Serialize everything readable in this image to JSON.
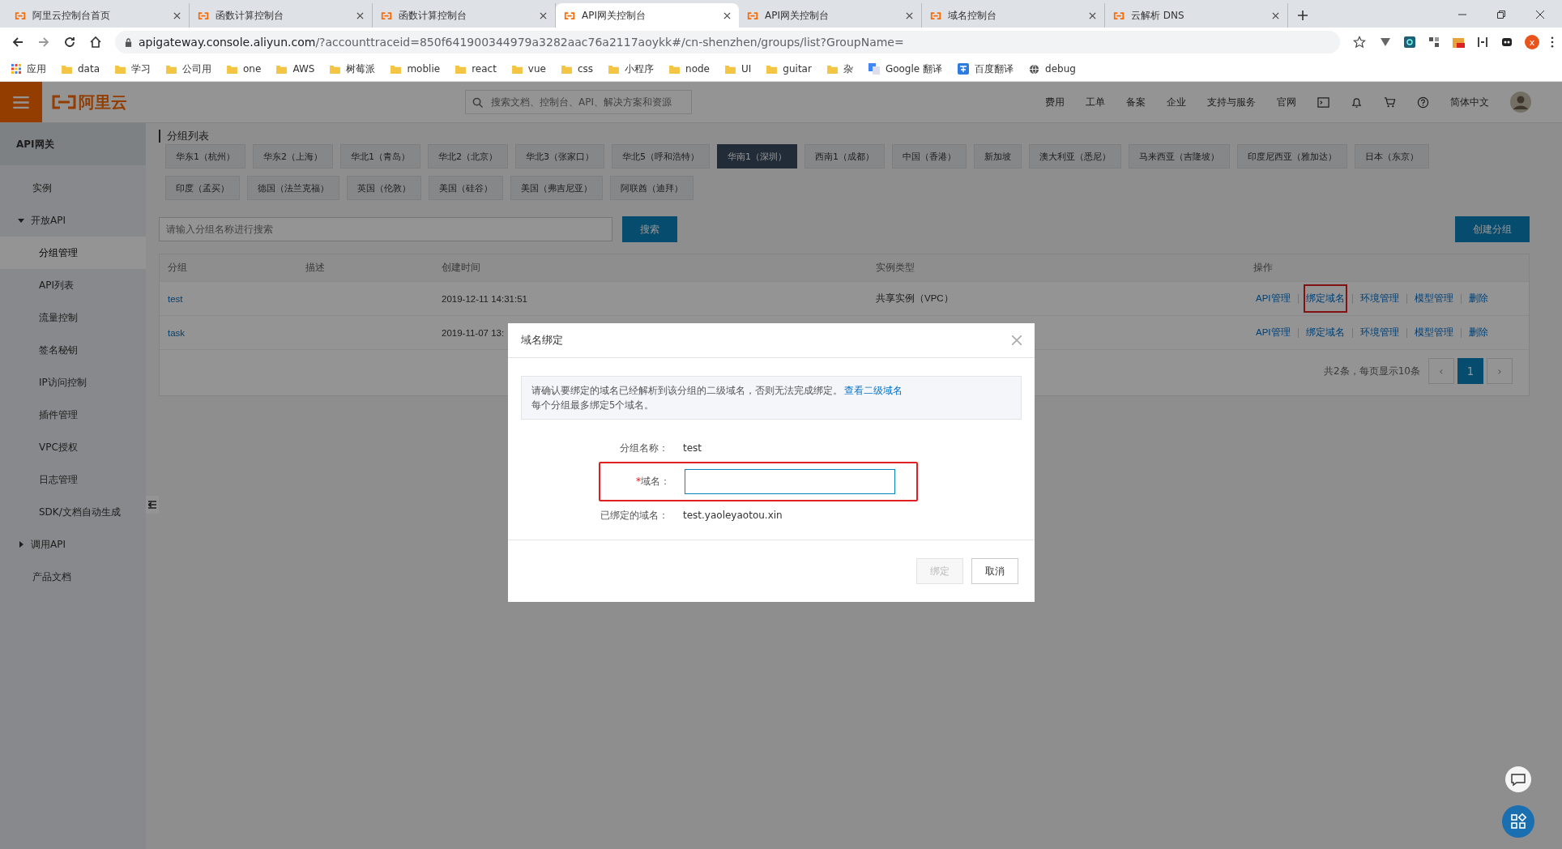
{
  "browser": {
    "tabs": [
      {
        "title": "阿里云控制台首页",
        "selected": false
      },
      {
        "title": "函数计算控制台",
        "selected": false
      },
      {
        "title": "函数计算控制台",
        "selected": false
      },
      {
        "title": "API网关控制台",
        "selected": true
      },
      {
        "title": "API网关控制台",
        "selected": false
      },
      {
        "title": "域名控制台",
        "selected": false
      },
      {
        "title": "云解析 DNS",
        "selected": false
      }
    ],
    "url_host": "apigateway.console.aliyun.com",
    "url_rest": "/?accounttraceid=850f641900344979a3282aac76a2117aoykk#/cn-shenzhen/groups/list?GroupName=",
    "profile_letter": "x",
    "bookmarks": [
      {
        "label": "应用",
        "kind": "apps"
      },
      {
        "label": "data",
        "kind": "folder"
      },
      {
        "label": "学习",
        "kind": "folder"
      },
      {
        "label": "公司用",
        "kind": "folder"
      },
      {
        "label": "one",
        "kind": "folder"
      },
      {
        "label": "AWS",
        "kind": "folder"
      },
      {
        "label": "树莓派",
        "kind": "folder"
      },
      {
        "label": "moblie",
        "kind": "folder"
      },
      {
        "label": "react",
        "kind": "folder"
      },
      {
        "label": "vue",
        "kind": "folder"
      },
      {
        "label": "css",
        "kind": "folder"
      },
      {
        "label": "小程序",
        "kind": "folder"
      },
      {
        "label": "node",
        "kind": "folder"
      },
      {
        "label": "UI",
        "kind": "folder"
      },
      {
        "label": "guitar",
        "kind": "folder"
      },
      {
        "label": "杂",
        "kind": "folder"
      },
      {
        "label": "Google 翻译",
        "kind": "translate"
      },
      {
        "label": "百度翻译",
        "kind": "baidu"
      },
      {
        "label": "debug",
        "kind": "link"
      }
    ]
  },
  "header": {
    "logo": "阿里云",
    "search_placeholder": "搜索文档、控制台、API、解决方案和资源",
    "nav": [
      "费用",
      "工单",
      "备案",
      "企业",
      "支持与服务",
      "官网"
    ],
    "language": "简体中文"
  },
  "sidebar": {
    "title": "API网关",
    "items": [
      {
        "label": "实例",
        "selected": false
      },
      {
        "label": "开放API",
        "expanded": true,
        "selected": false,
        "children": [
          {
            "label": "分组管理",
            "selected": true
          },
          {
            "label": "API列表",
            "selected": false
          },
          {
            "label": "流量控制",
            "selected": false
          },
          {
            "label": "签名秘钥",
            "selected": false
          },
          {
            "label": "IP访问控制",
            "selected": false
          },
          {
            "label": "插件管理",
            "selected": false
          },
          {
            "label": "VPC授权",
            "selected": false
          },
          {
            "label": "日志管理",
            "selected": false
          },
          {
            "label": "SDK/文档自动生成",
            "selected": false
          }
        ]
      },
      {
        "label": "调用API",
        "expanded": false,
        "selected": false
      },
      {
        "label": "产品文档",
        "selected": false
      }
    ]
  },
  "page": {
    "title": "分组列表",
    "regions": [
      {
        "label": "华东1（杭州）",
        "selected": false
      },
      {
        "label": "华东2（上海）",
        "selected": false
      },
      {
        "label": "华北1（青岛）",
        "selected": false
      },
      {
        "label": "华北2（北京）",
        "selected": false
      },
      {
        "label": "华北3（张家口）",
        "selected": false
      },
      {
        "label": "华北5（呼和浩特）",
        "selected": false
      },
      {
        "label": "华南1（深圳）",
        "selected": true
      },
      {
        "label": "西南1（成都）",
        "selected": false
      },
      {
        "label": "中国（香港）",
        "selected": false
      },
      {
        "label": "新加坡",
        "selected": false
      },
      {
        "label": "澳大利亚（悉尼）",
        "selected": false
      },
      {
        "label": "马来西亚（吉隆坡）",
        "selected": false
      },
      {
        "label": "印度尼西亚（雅加达）",
        "selected": false
      },
      {
        "label": "日本（东京）",
        "selected": false
      },
      {
        "label": "印度（孟买）",
        "selected": false
      },
      {
        "label": "德国（法兰克福）",
        "selected": false
      },
      {
        "label": "英国（伦敦）",
        "selected": false
      },
      {
        "label": "美国（硅谷）",
        "selected": false
      },
      {
        "label": "美国（弗吉尼亚）",
        "selected": false
      },
      {
        "label": "阿联酋（迪拜）",
        "selected": false
      }
    ],
    "search_placeholder": "请输入分组名称进行搜索",
    "search_button": "搜索",
    "create_button": "创建分组",
    "table": {
      "columns": [
        "分组",
        "描述",
        "创建时间",
        "实例类型",
        "操作"
      ],
      "rows": [
        {
          "group": "test",
          "created": "2019-12-11 14:31:51",
          "instance_type": "共享实例（VPC）",
          "actions": [
            {
              "label": "API管理",
              "highlighted": false
            },
            {
              "label": "绑定域名",
              "highlighted": true
            },
            {
              "label": "环境管理",
              "highlighted": false
            },
            {
              "label": "模型管理",
              "highlighted": false
            },
            {
              "label": "删除",
              "highlighted": false
            }
          ]
        },
        {
          "group": "task",
          "created": "2019-11-07 13:",
          "actions": [
            {
              "label": "API管理",
              "highlighted": false
            },
            {
              "label": "绑定域名",
              "highlighted": false
            },
            {
              "label": "环境管理",
              "highlighted": false
            },
            {
              "label": "模型管理",
              "highlighted": false
            },
            {
              "label": "删除",
              "highlighted": false
            }
          ]
        }
      ]
    },
    "pagination": {
      "summary": "共2条，每页显示10条",
      "prev": "‹",
      "pages": [
        {
          "label": "1",
          "selected": true
        }
      ],
      "next": "›"
    }
  },
  "dialog": {
    "title": "域名绑定",
    "notice": "请确认要绑定的域名已经解析到该分组的二级域名，否则无法完成绑定。",
    "notice_link": "查看二级域名",
    "notice_limit": "每个分组最多绑定5个域名。",
    "group_label": "分组名称：",
    "group_value": "test",
    "domain_field": {
      "required_mark": "*",
      "label": "域名：",
      "highlighted": true
    },
    "bound_label": "已绑定的域名：",
    "bound_value": "test.yaoleyaotou.xin",
    "buttons": [
      {
        "label": "绑定",
        "disabled": true
      },
      {
        "label": "取消",
        "disabled": false
      }
    ]
  }
}
